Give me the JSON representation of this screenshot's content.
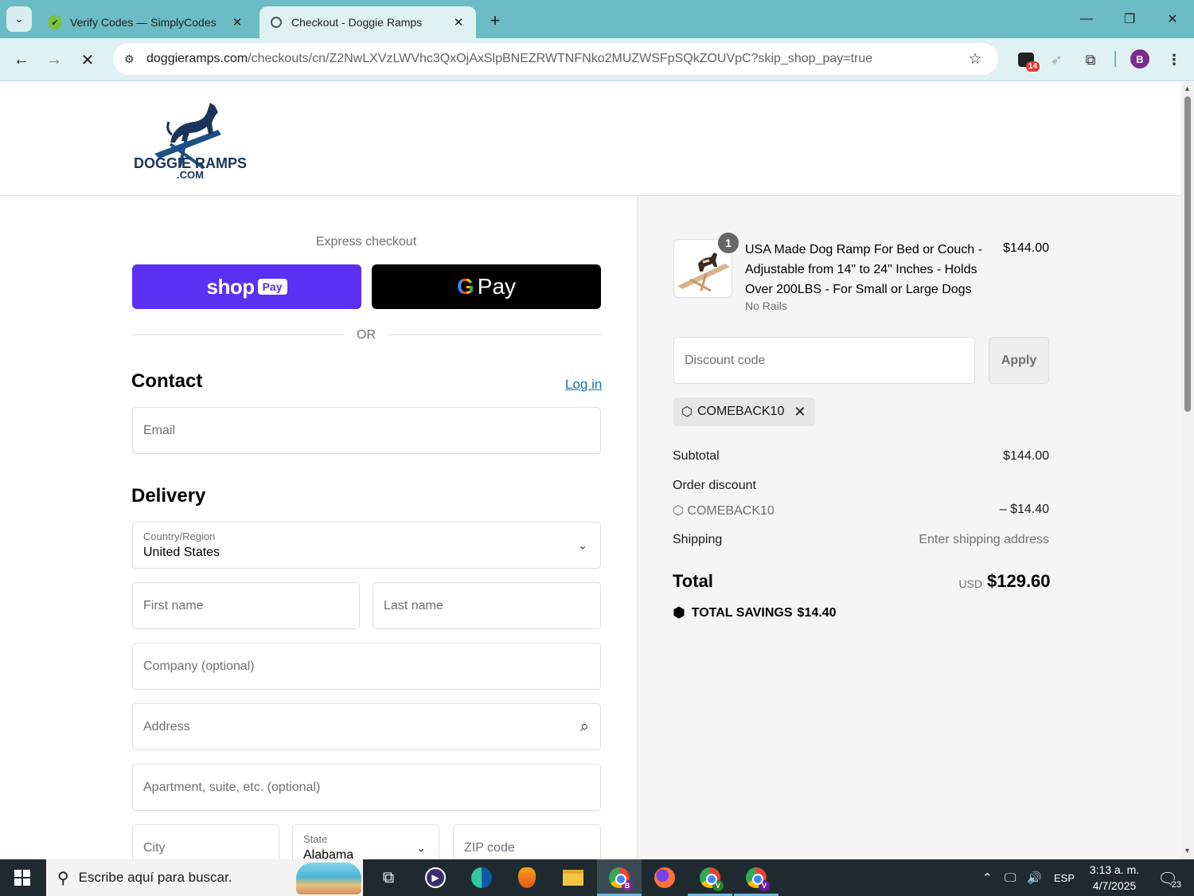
{
  "browser": {
    "tabs": [
      {
        "title": "Verify Codes — SimplyCodes"
      },
      {
        "title": "Checkout - Doggie Ramps"
      }
    ],
    "url_domain": "doggieramps.com",
    "url_path": "/checkouts/cn/Z2NwLXVzLWVhc3QxOjAxSlpBNEZRWTNFNko2MUZWSFpSQkZOUVpC?skip_shop_pay=true",
    "extension_badge": "14",
    "profile_initial": "B"
  },
  "header": {
    "logo_line1": "DOGGIE RAMPS",
    "logo_line2": ".COM"
  },
  "checkout": {
    "express_label": "Express checkout",
    "shop_pay_word": "shop",
    "shop_pay_chip": "Pay",
    "gpay_g": "G",
    "gpay_word": "Pay",
    "or_text": "OR",
    "contact_title": "Contact",
    "login_link": "Log in",
    "email_placeholder": "Email",
    "delivery_title": "Delivery",
    "country_label": "Country/Region",
    "country_value": "United States",
    "first_name": "First name",
    "last_name": "Last name",
    "company": "Company (optional)",
    "address": "Address",
    "apartment": "Apartment, suite, etc. (optional)",
    "city": "City",
    "state_label": "State",
    "state_value": "Alabama",
    "zip": "ZIP code"
  },
  "summary": {
    "item": {
      "quantity": "1",
      "name": "USA Made Dog Ramp For Bed or Couch - Adjustable from 14\" to 24\" Inches - Holds Over 200LBS - For Small or Large Dogs",
      "variant": "No Rails",
      "price": "$144.00"
    },
    "discount_placeholder": "Discount code",
    "apply_label": "Apply",
    "applied_code": "COMEBACK10",
    "subtotal_label": "Subtotal",
    "subtotal_value": "$144.00",
    "order_discount_label": "Order discount",
    "discount_code": "COMEBACK10",
    "discount_value": "– $14.40",
    "shipping_label": "Shipping",
    "shipping_value": "Enter shipping address",
    "total_label": "Total",
    "total_currency": "USD",
    "total_value": "$129.60",
    "savings_label": "TOTAL SAVINGS",
    "savings_value": "$14.40"
  },
  "taskbar": {
    "search_placeholder": "Escribe aquí para buscar.",
    "language": "ESP",
    "time": "3:13 a. m.",
    "date": "4/7/2025",
    "notifications": "23"
  }
}
